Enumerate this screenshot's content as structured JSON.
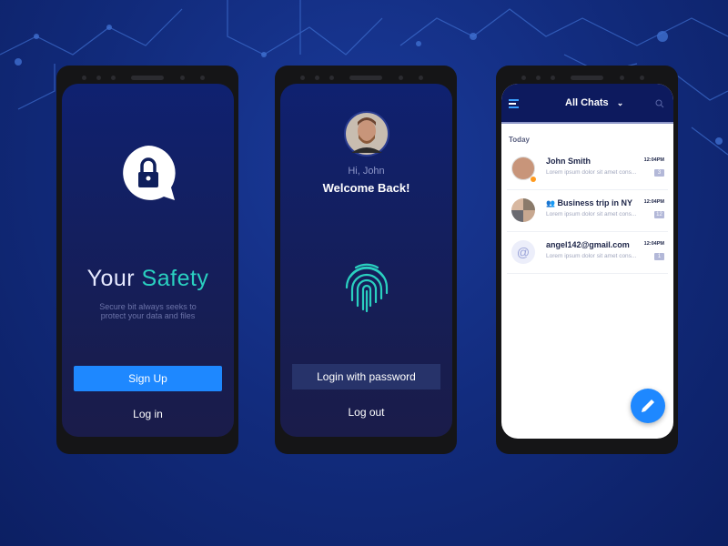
{
  "colors": {
    "background": "#112a7a",
    "primary_button": "#1e88ff",
    "accent_teal": "#2ad0c0",
    "chat_header": "#0d1a5e"
  },
  "welcome": {
    "lock_icon": "lock-icon",
    "title_part1": "Your",
    "title_part2": "Safety",
    "subtitle_line1": "Secure bit always seeks to",
    "subtitle_line2": "protect your data and files",
    "signup": "Sign Up",
    "login": "Log in"
  },
  "login": {
    "greeting": "Hi, John",
    "welcome": "Welcome Back!",
    "fingerprint_icon": "fingerprint-icon",
    "password_button": "Login with password",
    "logout": "Log out"
  },
  "chats": {
    "title": "All Chats",
    "section": "Today",
    "items": [
      {
        "name": "John Smith",
        "preview": "Lorem ipsum dolor sit amet cons...",
        "time": "12:04PM",
        "count": "3",
        "online": true
      },
      {
        "name": "Business trip in NY",
        "preview": "Lorem ipsum dolor sit amet cons...",
        "time": "12:04PM",
        "count": "12",
        "group": true
      },
      {
        "name": "angel142@gmail.com",
        "preview": "Lorem ipsum dolor sit amet cons...",
        "time": "12:04PM",
        "count": "1"
      }
    ]
  }
}
